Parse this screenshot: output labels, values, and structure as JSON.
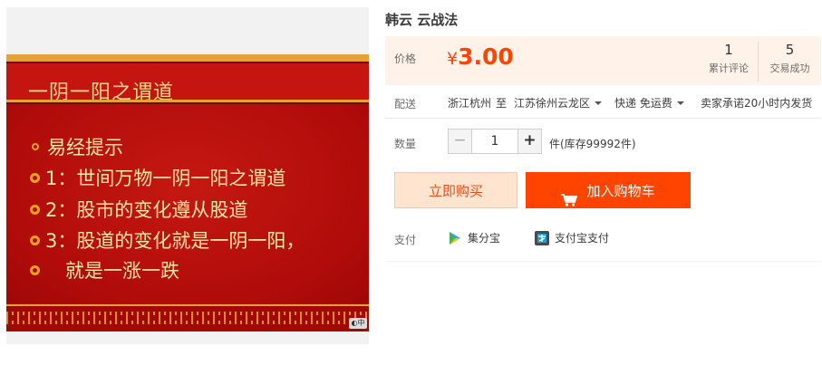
{
  "slide": {
    "title": "一阴一阳之谓道",
    "lines": [
      "易经提示",
      "1：世间万物一阴一阳之谓道",
      "2：股市的变化遵从股道",
      "3：股道的变化就是一阴一阳，",
      "就是一涨一跌"
    ],
    "badge": "中"
  },
  "product": {
    "title": "韩云 云战法"
  },
  "price": {
    "label": "价格",
    "currency": "¥",
    "value": "3.00",
    "color": "#ff4400"
  },
  "stats": [
    {
      "value": "1",
      "label": "累计评论"
    },
    {
      "value": "5",
      "label": "交易成功"
    }
  ],
  "shipping": {
    "label": "配送",
    "from": "浙江杭州",
    "to_word": "至",
    "destination": "江苏徐州云龙区",
    "method": "快递 免运费",
    "promise": "卖家承诺20小时内发货"
  },
  "quantity": {
    "label": "数量",
    "value": "1",
    "minus": "−",
    "plus": "+",
    "stock_text": "件(库存99992件)"
  },
  "actions": {
    "buy_now": "立即购买",
    "add_to_cart": "加入购物车",
    "cart_icon": "shopping-cart-icon"
  },
  "payment": {
    "label": "支付",
    "methods": [
      {
        "name": "集分宝",
        "icon": "jifenbao-icon"
      },
      {
        "name": "支付宝支付",
        "icon": "alipay-icon"
      }
    ]
  },
  "colors": {
    "accent": "#ff4400",
    "price_box_bg": "#fff2e8",
    "slide_red": "#bc0d0c",
    "slide_gold": "#e6a23a"
  }
}
